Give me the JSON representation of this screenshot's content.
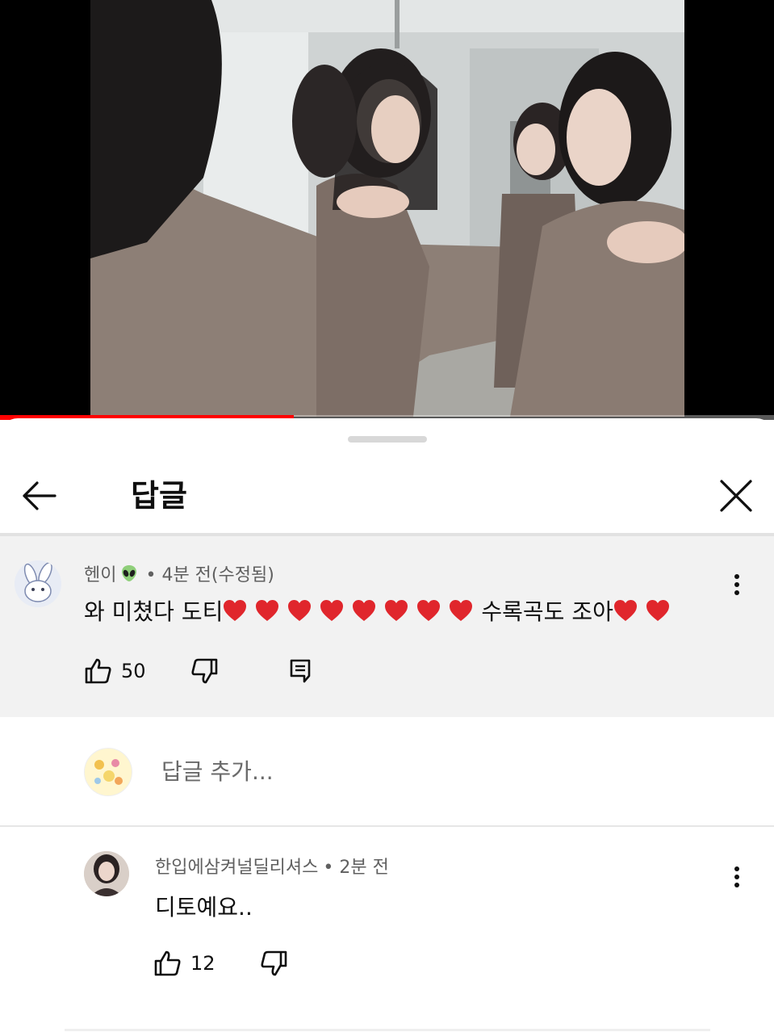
{
  "video": {
    "progress_percent": 38,
    "accent_color": "#ff0000"
  },
  "header": {
    "title": "답글",
    "back_icon": "arrow-left-icon",
    "close_icon": "close-icon"
  },
  "parent_comment": {
    "author": "헨이",
    "author_badge_icon": "alien-emoji-icon",
    "meta": "• 4분 전(수정됨)",
    "text_before": "와 미쳤다 도티",
    "hearts_first": 8,
    "text_after": "수록곡도 조아",
    "hearts_last": 2,
    "like_count": "50"
  },
  "add_reply": {
    "placeholder": "답글 추가..."
  },
  "reply": {
    "author": "한입에삼켜널딜리셔스",
    "meta": "• 2분 전",
    "text": "디토예요..",
    "like_count": "12"
  }
}
